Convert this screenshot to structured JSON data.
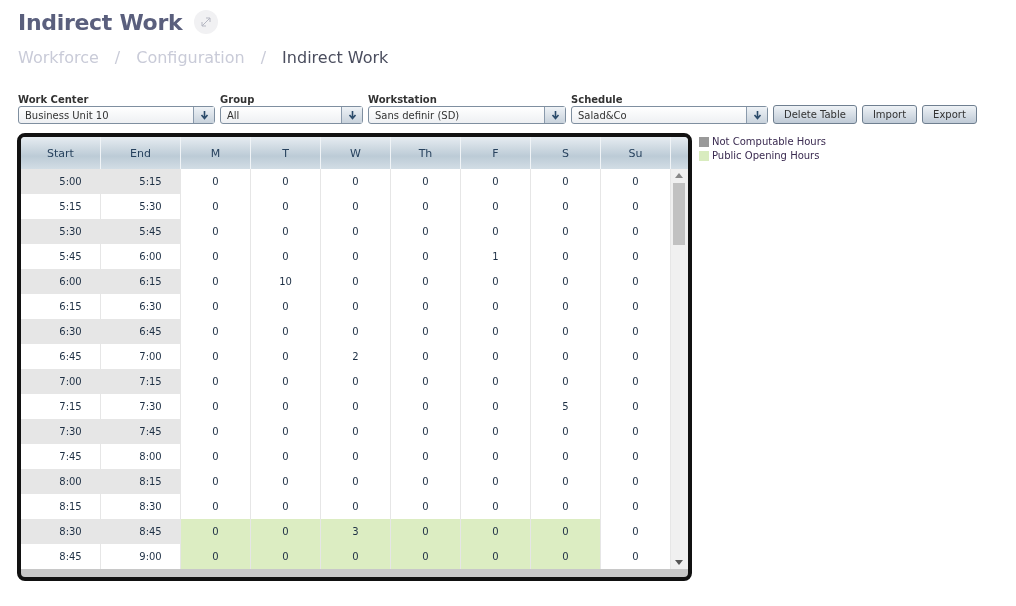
{
  "page_title": "Indirect Work",
  "breadcrumb": [
    {
      "label": "Workforce",
      "current": false
    },
    {
      "label": "Configuration",
      "current": false
    },
    {
      "label": "Indirect Work",
      "current": true
    }
  ],
  "breadcrumb_separator": "/",
  "filters": [
    {
      "label": "Work Center",
      "value": "Business Unit 10"
    },
    {
      "label": "Group",
      "value": "All"
    },
    {
      "label": "Workstation",
      "value": "Sans definir (SD)"
    },
    {
      "label": "Schedule",
      "value": "Salad&Co"
    }
  ],
  "buttons": [
    "Delete Table",
    "Import",
    "Export"
  ],
  "table": {
    "columns": [
      "Start",
      "End",
      "M",
      "T",
      "W",
      "Th",
      "F",
      "S",
      "Su"
    ],
    "rows": [
      [
        {
          "kind": "time",
          "value": "5:00"
        },
        {
          "kind": "time",
          "value": "5:15"
        },
        {
          "kind": "count",
          "value": "0",
          "public_opening": false
        },
        {
          "kind": "count",
          "value": "0",
          "public_opening": false
        },
        {
          "kind": "count",
          "value": "0",
          "public_opening": false
        },
        {
          "kind": "count",
          "value": "0",
          "public_opening": false
        },
        {
          "kind": "count",
          "value": "0",
          "public_opening": false
        },
        {
          "kind": "count",
          "value": "0",
          "public_opening": false
        },
        {
          "kind": "count",
          "value": "0",
          "public_opening": false
        }
      ],
      [
        {
          "kind": "time",
          "value": "5:15"
        },
        {
          "kind": "time",
          "value": "5:30"
        },
        {
          "kind": "count",
          "value": "0",
          "public_opening": false
        },
        {
          "kind": "count",
          "value": "0",
          "public_opening": false
        },
        {
          "kind": "count",
          "value": "0",
          "public_opening": false
        },
        {
          "kind": "count",
          "value": "0",
          "public_opening": false
        },
        {
          "kind": "count",
          "value": "0",
          "public_opening": false
        },
        {
          "kind": "count",
          "value": "0",
          "public_opening": false
        },
        {
          "kind": "count",
          "value": "0",
          "public_opening": false
        }
      ],
      [
        {
          "kind": "time",
          "value": "5:30"
        },
        {
          "kind": "time",
          "value": "5:45"
        },
        {
          "kind": "count",
          "value": "0",
          "public_opening": false
        },
        {
          "kind": "count",
          "value": "0",
          "public_opening": false
        },
        {
          "kind": "count",
          "value": "0",
          "public_opening": false
        },
        {
          "kind": "count",
          "value": "0",
          "public_opening": false
        },
        {
          "kind": "count",
          "value": "0",
          "public_opening": false
        },
        {
          "kind": "count",
          "value": "0",
          "public_opening": false
        },
        {
          "kind": "count",
          "value": "0",
          "public_opening": false
        }
      ],
      [
        {
          "kind": "time",
          "value": "5:45"
        },
        {
          "kind": "time",
          "value": "6:00"
        },
        {
          "kind": "count",
          "value": "0",
          "public_opening": false
        },
        {
          "kind": "count",
          "value": "0",
          "public_opening": false
        },
        {
          "kind": "count",
          "value": "0",
          "public_opening": false
        },
        {
          "kind": "count",
          "value": "0",
          "public_opening": false
        },
        {
          "kind": "count",
          "value": "1",
          "public_opening": false
        },
        {
          "kind": "count",
          "value": "0",
          "public_opening": false
        },
        {
          "kind": "count",
          "value": "0",
          "public_opening": false
        }
      ],
      [
        {
          "kind": "time",
          "value": "6:00"
        },
        {
          "kind": "time",
          "value": "6:15"
        },
        {
          "kind": "count",
          "value": "0",
          "public_opening": false
        },
        {
          "kind": "count",
          "value": "10",
          "public_opening": false
        },
        {
          "kind": "count",
          "value": "0",
          "public_opening": false
        },
        {
          "kind": "count",
          "value": "0",
          "public_opening": false
        },
        {
          "kind": "count",
          "value": "0",
          "public_opening": false
        },
        {
          "kind": "count",
          "value": "0",
          "public_opening": false
        },
        {
          "kind": "count",
          "value": "0",
          "public_opening": false
        }
      ],
      [
        {
          "kind": "time",
          "value": "6:15"
        },
        {
          "kind": "time",
          "value": "6:30"
        },
        {
          "kind": "count",
          "value": "0",
          "public_opening": false
        },
        {
          "kind": "count",
          "value": "0",
          "public_opening": false
        },
        {
          "kind": "count",
          "value": "0",
          "public_opening": false
        },
        {
          "kind": "count",
          "value": "0",
          "public_opening": false
        },
        {
          "kind": "count",
          "value": "0",
          "public_opening": false
        },
        {
          "kind": "count",
          "value": "0",
          "public_opening": false
        },
        {
          "kind": "count",
          "value": "0",
          "public_opening": false
        }
      ],
      [
        {
          "kind": "time",
          "value": "6:30"
        },
        {
          "kind": "time",
          "value": "6:45"
        },
        {
          "kind": "count",
          "value": "0",
          "public_opening": false
        },
        {
          "kind": "count",
          "value": "0",
          "public_opening": false
        },
        {
          "kind": "count",
          "value": "0",
          "public_opening": false
        },
        {
          "kind": "count",
          "value": "0",
          "public_opening": false
        },
        {
          "kind": "count",
          "value": "0",
          "public_opening": false
        },
        {
          "kind": "count",
          "value": "0",
          "public_opening": false
        },
        {
          "kind": "count",
          "value": "0",
          "public_opening": false
        }
      ],
      [
        {
          "kind": "time",
          "value": "6:45"
        },
        {
          "kind": "time",
          "value": "7:00"
        },
        {
          "kind": "count",
          "value": "0",
          "public_opening": false
        },
        {
          "kind": "count",
          "value": "0",
          "public_opening": false
        },
        {
          "kind": "count",
          "value": "2",
          "public_opening": false
        },
        {
          "kind": "count",
          "value": "0",
          "public_opening": false
        },
        {
          "kind": "count",
          "value": "0",
          "public_opening": false
        },
        {
          "kind": "count",
          "value": "0",
          "public_opening": false
        },
        {
          "kind": "count",
          "value": "0",
          "public_opening": false
        }
      ],
      [
        {
          "kind": "time",
          "value": "7:00"
        },
        {
          "kind": "time",
          "value": "7:15"
        },
        {
          "kind": "count",
          "value": "0",
          "public_opening": false
        },
        {
          "kind": "count",
          "value": "0",
          "public_opening": false
        },
        {
          "kind": "count",
          "value": "0",
          "public_opening": false
        },
        {
          "kind": "count",
          "value": "0",
          "public_opening": false
        },
        {
          "kind": "count",
          "value": "0",
          "public_opening": false
        },
        {
          "kind": "count",
          "value": "0",
          "public_opening": false
        },
        {
          "kind": "count",
          "value": "0",
          "public_opening": false
        }
      ],
      [
        {
          "kind": "time",
          "value": "7:15"
        },
        {
          "kind": "time",
          "value": "7:30"
        },
        {
          "kind": "count",
          "value": "0",
          "public_opening": false
        },
        {
          "kind": "count",
          "value": "0",
          "public_opening": false
        },
        {
          "kind": "count",
          "value": "0",
          "public_opening": false
        },
        {
          "kind": "count",
          "value": "0",
          "public_opening": false
        },
        {
          "kind": "count",
          "value": "0",
          "public_opening": false
        },
        {
          "kind": "count",
          "value": "5",
          "public_opening": false
        },
        {
          "kind": "count",
          "value": "0",
          "public_opening": false
        }
      ],
      [
        {
          "kind": "time",
          "value": "7:30"
        },
        {
          "kind": "time",
          "value": "7:45"
        },
        {
          "kind": "count",
          "value": "0",
          "public_opening": false
        },
        {
          "kind": "count",
          "value": "0",
          "public_opening": false
        },
        {
          "kind": "count",
          "value": "0",
          "public_opening": false
        },
        {
          "kind": "count",
          "value": "0",
          "public_opening": false
        },
        {
          "kind": "count",
          "value": "0",
          "public_opening": false
        },
        {
          "kind": "count",
          "value": "0",
          "public_opening": false
        },
        {
          "kind": "count",
          "value": "0",
          "public_opening": false
        }
      ],
      [
        {
          "kind": "time",
          "value": "7:45"
        },
        {
          "kind": "time",
          "value": "8:00"
        },
        {
          "kind": "count",
          "value": "0",
          "public_opening": false
        },
        {
          "kind": "count",
          "value": "0",
          "public_opening": false
        },
        {
          "kind": "count",
          "value": "0",
          "public_opening": false
        },
        {
          "kind": "count",
          "value": "0",
          "public_opening": false
        },
        {
          "kind": "count",
          "value": "0",
          "public_opening": false
        },
        {
          "kind": "count",
          "value": "0",
          "public_opening": false
        },
        {
          "kind": "count",
          "value": "0",
          "public_opening": false
        }
      ],
      [
        {
          "kind": "time",
          "value": "8:00"
        },
        {
          "kind": "time",
          "value": "8:15"
        },
        {
          "kind": "count",
          "value": "0",
          "public_opening": false
        },
        {
          "kind": "count",
          "value": "0",
          "public_opening": false
        },
        {
          "kind": "count",
          "value": "0",
          "public_opening": false
        },
        {
          "kind": "count",
          "value": "0",
          "public_opening": false
        },
        {
          "kind": "count",
          "value": "0",
          "public_opening": false
        },
        {
          "kind": "count",
          "value": "0",
          "public_opening": false
        },
        {
          "kind": "count",
          "value": "0",
          "public_opening": false
        }
      ],
      [
        {
          "kind": "time",
          "value": "8:15"
        },
        {
          "kind": "time",
          "value": "8:30"
        },
        {
          "kind": "count",
          "value": "0",
          "public_opening": false
        },
        {
          "kind": "count",
          "value": "0",
          "public_opening": false
        },
        {
          "kind": "count",
          "value": "0",
          "public_opening": false
        },
        {
          "kind": "count",
          "value": "0",
          "public_opening": false
        },
        {
          "kind": "count",
          "value": "0",
          "public_opening": false
        },
        {
          "kind": "count",
          "value": "0",
          "public_opening": false
        },
        {
          "kind": "count",
          "value": "0",
          "public_opening": false
        }
      ],
      [
        {
          "kind": "time",
          "value": "8:30"
        },
        {
          "kind": "time",
          "value": "8:45"
        },
        {
          "kind": "count",
          "value": "0",
          "public_opening": true
        },
        {
          "kind": "count",
          "value": "0",
          "public_opening": true
        },
        {
          "kind": "count",
          "value": "3",
          "public_opening": true
        },
        {
          "kind": "count",
          "value": "0",
          "public_opening": true
        },
        {
          "kind": "count",
          "value": "0",
          "public_opening": true
        },
        {
          "kind": "count",
          "value": "0",
          "public_opening": true
        },
        {
          "kind": "count",
          "value": "0",
          "public_opening": false
        }
      ],
      [
        {
          "kind": "time",
          "value": "8:45"
        },
        {
          "kind": "time",
          "value": "9:00"
        },
        {
          "kind": "count",
          "value": "0",
          "public_opening": true
        },
        {
          "kind": "count",
          "value": "0",
          "public_opening": true
        },
        {
          "kind": "count",
          "value": "0",
          "public_opening": true
        },
        {
          "kind": "count",
          "value": "0",
          "public_opening": true
        },
        {
          "kind": "count",
          "value": "0",
          "public_opening": true
        },
        {
          "kind": "count",
          "value": "0",
          "public_opening": true
        },
        {
          "kind": "count",
          "value": "0",
          "public_opening": false
        }
      ]
    ]
  },
  "legend": [
    {
      "label": "Not Computable Hours",
      "color": "#999999"
    },
    {
      "label": "Public Opening Hours",
      "color": "#d9ecbf"
    }
  ]
}
